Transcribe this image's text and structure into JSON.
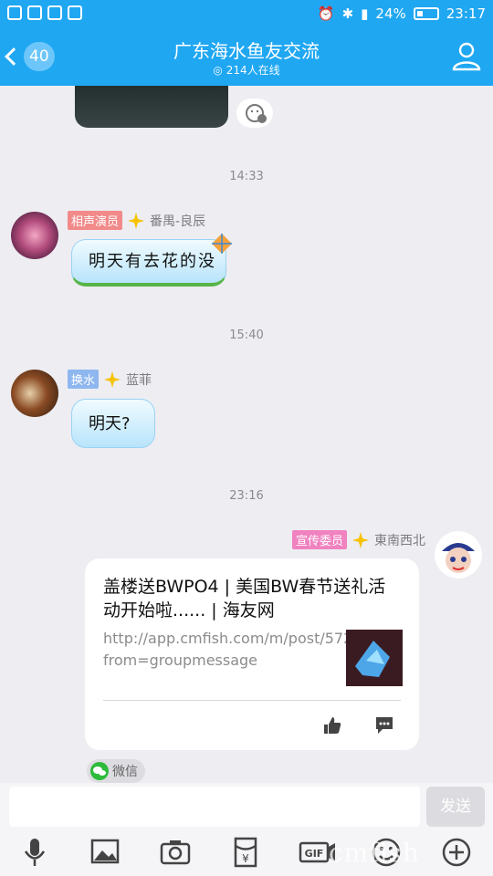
{
  "status_bar": {
    "battery": "24%",
    "time": "23:17"
  },
  "header": {
    "unread_count": "40",
    "title": "广东海水鱼友交流",
    "online": "214人在线"
  },
  "messages": [
    {
      "time": "14:33",
      "role": "相声演员",
      "role_color": "#f28a8a",
      "sender": "番禺-良辰",
      "text": "明天有去花的没"
    },
    {
      "time": "15:40",
      "role": "换水",
      "role_color": "#8fb7ef",
      "sender": "蓝菲",
      "text": "明天?"
    },
    {
      "time": "23:16",
      "role": "宣传委员",
      "role_color": "#f082c0",
      "sender": "東南西北",
      "card": {
        "title": "盖楼送BWPO4 | 美国BW春节送礼活动开始啦...... | 海友网",
        "url": "http://app.cmfish.com/m/post/572088?from=groupmessage"
      },
      "source": "微信"
    }
  ],
  "input": {
    "value": "",
    "send_label": "发送"
  },
  "toolbar": [
    "mic-icon",
    "image-icon",
    "camera-icon",
    "red-packet-icon",
    "gif-icon",
    "emoji-icon",
    "plus-icon"
  ],
  "watermark": "cmfish"
}
